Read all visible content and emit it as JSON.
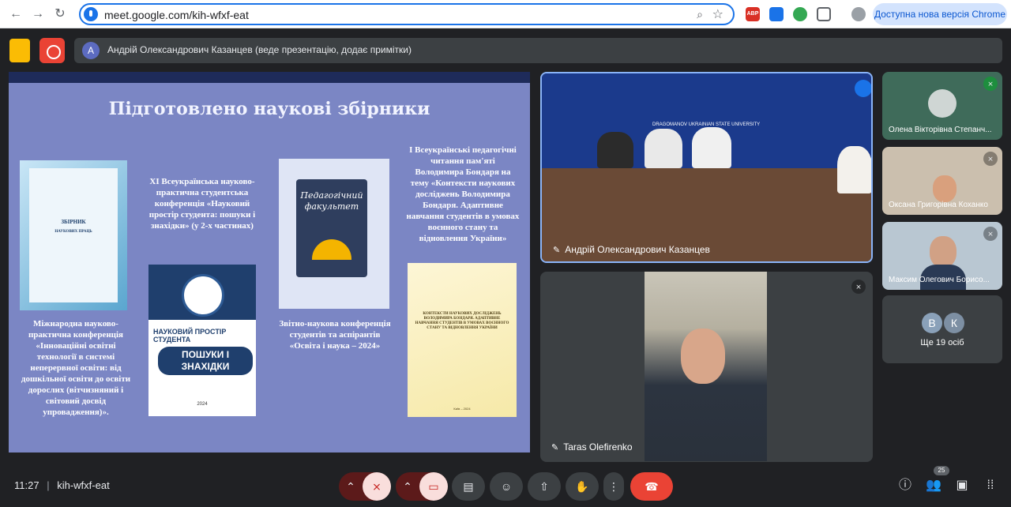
{
  "browser": {
    "url": "meet.google.com/kih-wfxf-eat",
    "update_label": "Доступна нова версія Chrome",
    "ext_abp": "ABP"
  },
  "meet": {
    "presenter_initial": "A",
    "presenter_text": "Андрій Олександрович Казанцев (веде презентацію, додає примітки)"
  },
  "slide": {
    "title": "Підготовлено наукові збірники",
    "item1_cover_title": "ЗБІРНИК",
    "item1_cover_subtitle": "НАУКОВИХ ПРАЦЬ",
    "item1_caption": "Міжнародна науково-практична конференція «Інноваційні освітні технології в системі неперервної освіти: від дошкільної освіти до освіти дорослих (вітчизняний і світовий досвід упровадження)».",
    "item2_caption": "XI Всеукраїнська науково-практична студентська конференція «Науковий простір студента: пошуки і знахідки» (у 2-х частинах)",
    "item2_cover_title": "НАУКОВИЙ ПРОСТІР СТУДЕНТА",
    "item2_cover_banner": "ПОШУКИ І ЗНАХІДКИ",
    "item2_cover_year": "2024",
    "item3_cover_title": "Педагогічний факультет",
    "item3_caption": "Звітно-наукова конференція студентів та аспірантів «Освіта і наука – 2024»",
    "item4_caption": "І Всеукраїнські педагогічні читання пам'яті Володимира Бондаря на тему «Контексти наукових досліджень Володимира Бондаря. Адаптивне навчання студентів в умовах воєнного стану та відновлення України»",
    "item4_cover_title": "КОНТЕКСТИ НАУКОВИХ ДОСЛІДЖЕНЬ ВОЛОДИМИРА БОНДАРЯ. АДАПТИВНЕ НАВЧАННЯ СТУДЕНТІВ В УМОВАХ ВОЄННОГО СТАНУ ТА ВІДНОВЛЕННЯ УКРАЇНИ",
    "item4_cover_footer": "Київ – 2024"
  },
  "tiles": {
    "main_name": "Андрій Олександрович Казанцев",
    "taras_name": "Taras Olefirenko",
    "side1_name": "Олена Вікторівна Степанч...",
    "side2_name": "Оксана Григорівна Коханко",
    "side3_name": "Максим Олегович Борисо...",
    "more_a": "В",
    "more_b": "К",
    "more_label": "Ще 19 осіб",
    "banner_text": "DRAGOMANOV UKRAINIAN STATE UNIVERSITY"
  },
  "bottom": {
    "time": "11:27",
    "meeting_code": "kih-wfxf-eat",
    "participants_count": "25"
  },
  "colors": {
    "accent": "#1a73e8",
    "end_call": "#ea4335",
    "slide_bg": "#7b86c4"
  }
}
